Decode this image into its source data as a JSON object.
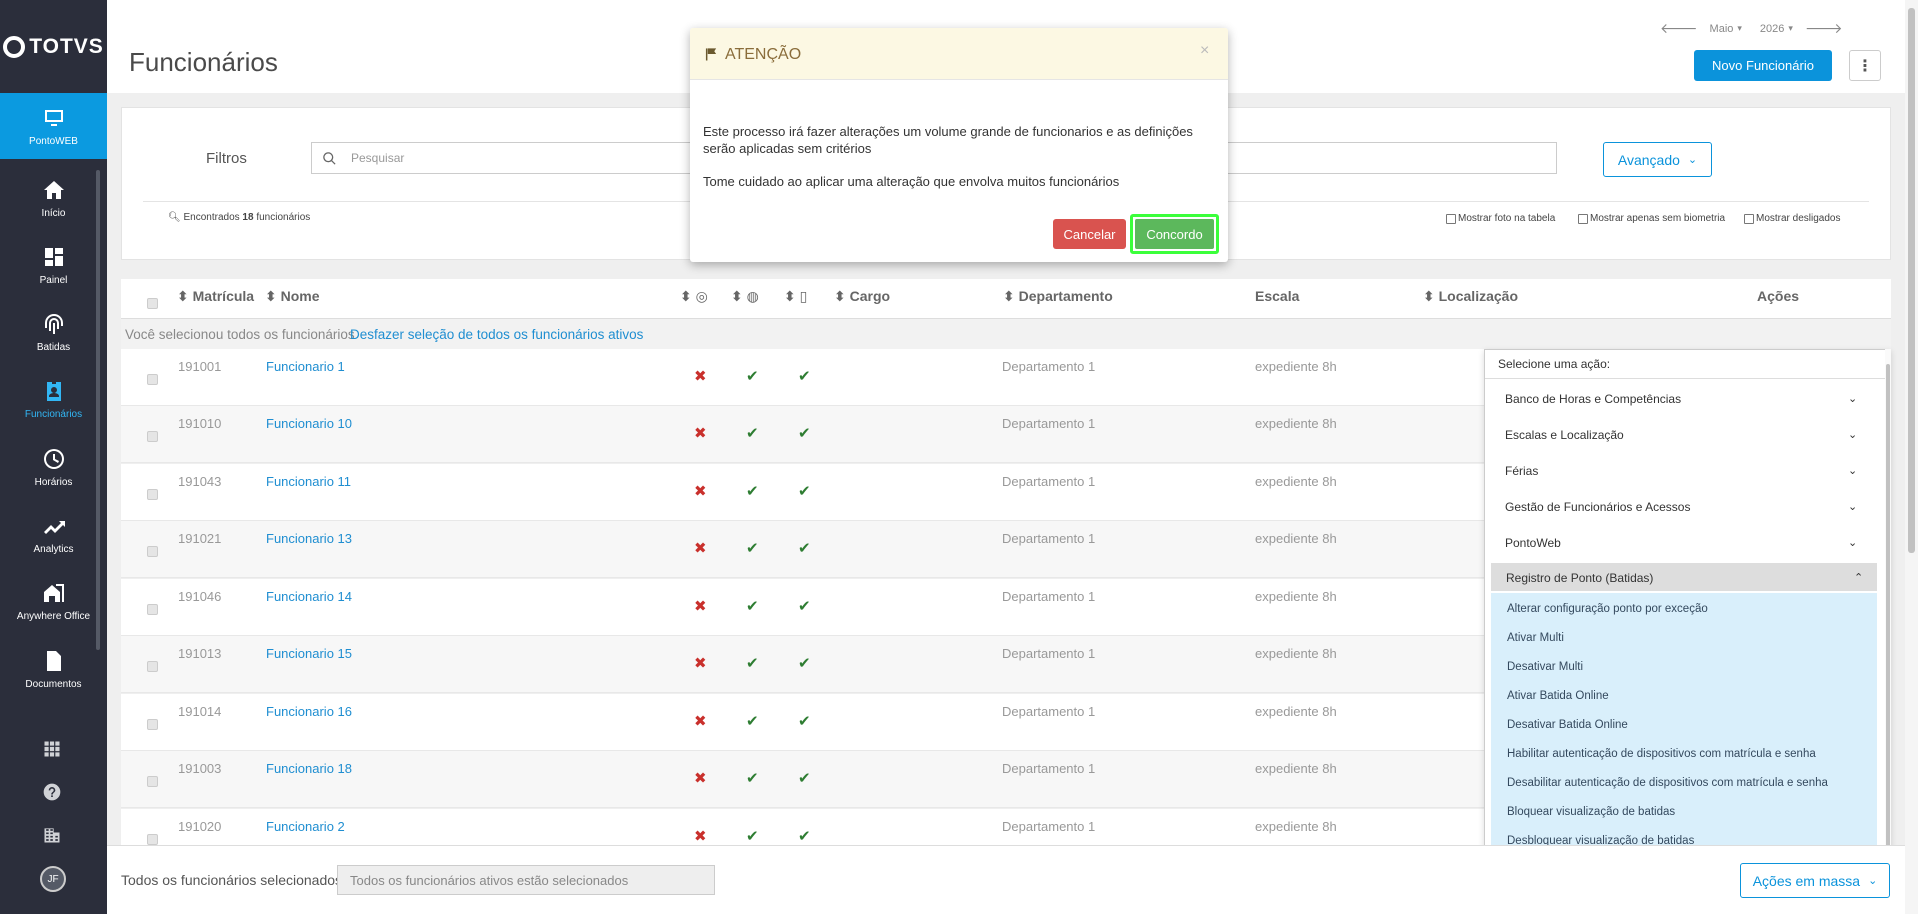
{
  "app": {
    "logo": "TOTVS",
    "page_title": "Funcionários"
  },
  "sidebar": {
    "items": [
      {
        "label": "PontoWEB",
        "icon": "monitor-icon"
      },
      {
        "label": "Início",
        "icon": "home-icon"
      },
      {
        "label": "Painel",
        "icon": "dashboard-icon"
      },
      {
        "label": "Batidas",
        "icon": "fingerprint-icon"
      },
      {
        "label": "Funcionários",
        "icon": "id-badge-icon"
      },
      {
        "label": "Horários",
        "icon": "clock-icon"
      },
      {
        "label": "Analytics",
        "icon": "trend-icon"
      },
      {
        "label": "Anywhere Office",
        "icon": "building-icon"
      },
      {
        "label": "Documentos",
        "icon": "document-icon"
      }
    ],
    "avatar": "JF"
  },
  "header": {
    "month": "Maio",
    "year": "2026",
    "new_button": "Novo Funcionário",
    "kebab": "⋮"
  },
  "filters": {
    "label": "Filtros",
    "search_placeholder": "Pesquisar",
    "advanced": "Avançado",
    "found_prefix": "Encontrados",
    "found_count": "18",
    "found_suffix": "funcionários",
    "options": [
      "Mostrar foto na tabela",
      "Mostrar apenas sem biometria",
      "Mostrar desligados"
    ]
  },
  "table": {
    "headers": {
      "matricula": "Matrícula",
      "nome": "Nome",
      "cargo": "Cargo",
      "departamento": "Departamento",
      "escala": "Escala",
      "localizacao": "Localização",
      "acoes": "Ações"
    },
    "selection_text": "Você selecionou todos os funcionários",
    "selection_link": "Desfazer seleção de todos os funcionários ativos",
    "rows": [
      {
        "matricula": "191001",
        "nome": "Funcionario 1",
        "departamento": "Departamento 1",
        "escala": "expediente 8h"
      },
      {
        "matricula": "191010",
        "nome": "Funcionario 10",
        "departamento": "Departamento 1",
        "escala": "expediente 8h"
      },
      {
        "matricula": "191043",
        "nome": "Funcionario 11",
        "departamento": "Departamento 1",
        "escala": "expediente 8h"
      },
      {
        "matricula": "191021",
        "nome": "Funcionario 13",
        "departamento": "Departamento 1",
        "escala": "expediente 8h"
      },
      {
        "matricula": "191046",
        "nome": "Funcionario 14",
        "departamento": "Departamento 1",
        "escala": "expediente 8h"
      },
      {
        "matricula": "191013",
        "nome": "Funcionario 15",
        "departamento": "Departamento 1",
        "escala": "expediente 8h"
      },
      {
        "matricula": "191014",
        "nome": "Funcionario 16",
        "departamento": "Departamento 1",
        "escala": "expediente 8h"
      },
      {
        "matricula": "191003",
        "nome": "Funcionario 18",
        "departamento": "Departamento 1",
        "escala": "expediente 8h"
      },
      {
        "matricula": "191020",
        "nome": "Funcionario 2",
        "departamento": "Departamento 1",
        "escala": "expediente 8h"
      }
    ]
  },
  "actions": {
    "title": "Selecione uma ação:",
    "groups": [
      "Banco de Horas e Competências",
      "Escalas e Localização",
      "Férias",
      "Gestão de Funcionários e Acessos",
      "PontoWeb",
      "Registro de Ponto (Batidas)"
    ],
    "items": [
      "Alterar configuração ponto por exceção",
      "Ativar Multi",
      "Desativar Multi",
      "Ativar Batida Online",
      "Desativar Batida Online",
      "Habilitar autenticação de dispositivos com matrícula e senha",
      "Desabilitar autenticação de dispositivos com matrícula e senha",
      "Bloquear visualização de batidas",
      "Desbloquear visualização de batidas"
    ]
  },
  "footer": {
    "label": "Todos os funcionários selecionados",
    "input_value": "Todos os funcionários ativos estão selecionados",
    "mass_button": "Ações em massa"
  },
  "modal": {
    "title": "ATENÇÃO",
    "close": "×",
    "text1": "Este processo irá fazer alterações um volume grande de funcionarios e as definições serão aplicadas sem critérios",
    "text2": "Tome cuidado ao aplicar uma alteração que envolva muitos funcionários",
    "cancel": "Cancelar",
    "confirm": "Concordo"
  },
  "colors": {
    "primary": "#0b93db",
    "sidebar": "#2b2e3b",
    "danger": "#d9534f",
    "success": "#5cb85c",
    "warning_bg": "#fcf8e3"
  }
}
